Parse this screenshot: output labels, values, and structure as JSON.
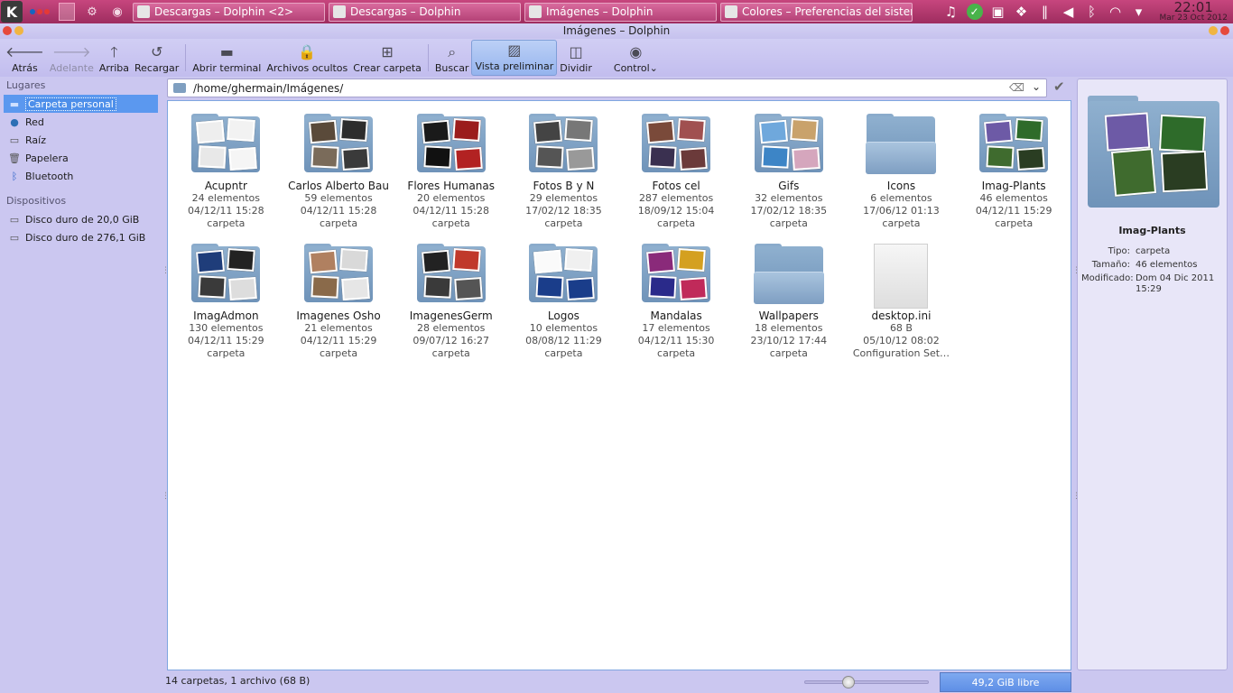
{
  "panel": {
    "tasks": [
      {
        "label": "Descargas – Dolphin <2>"
      },
      {
        "label": "Descargas – Dolphin"
      },
      {
        "label": "Imágenes – Dolphin"
      },
      {
        "label": "Colores – Preferencias del sistema"
      }
    ],
    "clock_time": "22:01",
    "clock_date": "Mar 23 Oct 2012"
  },
  "window": {
    "title": "Imágenes – Dolphin"
  },
  "toolbar": {
    "back": "Atrás",
    "forward": "Adelante",
    "up": "Arriba",
    "reload": "Recargar",
    "terminal": "Abrir terminal",
    "hidden": "Archivos ocultos",
    "new_folder": "Crear carpeta",
    "search": "Buscar",
    "preview": "Vista preliminar",
    "split": "Dividir",
    "control": "Control"
  },
  "places": {
    "heading": "Lugares",
    "items": [
      {
        "label": "Carpeta personal",
        "icon": "home-icon"
      },
      {
        "label": "Red",
        "icon": "network-icon"
      },
      {
        "label": "Raíz",
        "icon": "drive-icon"
      },
      {
        "label": "Papelera",
        "icon": "trash-icon"
      },
      {
        "label": "Bluetooth",
        "icon": "bluetooth-icon"
      }
    ],
    "devices_heading": "Dispositivos",
    "devices": [
      {
        "label": "Disco duro de 20,0 GiB"
      },
      {
        "label": "Disco duro de 276,1 GiB"
      }
    ]
  },
  "location": {
    "path": "/home/ghermain/Imágenes/"
  },
  "files": [
    {
      "name": "Acupntr",
      "count": "24 elementos",
      "date": "04/12/11 15:28",
      "type": "carpeta"
    },
    {
      "name": "Carlos Alberto Bau",
      "count": "59 elementos",
      "date": "04/12/11 15:28",
      "type": "carpeta"
    },
    {
      "name": "Flores Humanas",
      "count": "20 elementos",
      "date": "04/12/11 15:28",
      "type": "carpeta"
    },
    {
      "name": "Fotos B y N",
      "count": "29 elementos",
      "date": "17/02/12 18:35",
      "type": "carpeta"
    },
    {
      "name": "Fotos cel",
      "count": "287 elementos",
      "date": "18/09/12 15:04",
      "type": "carpeta"
    },
    {
      "name": "Gifs",
      "count": "32 elementos",
      "date": "17/02/12 18:35",
      "type": "carpeta"
    },
    {
      "name": "Icons",
      "count": "6 elementos",
      "date": "17/06/12 01:13",
      "type": "carpeta"
    },
    {
      "name": "Imag-Plants",
      "count": "46 elementos",
      "date": "04/12/11 15:29",
      "type": "carpeta"
    },
    {
      "name": "ImagAdmon",
      "count": "130 elementos",
      "date": "04/12/11 15:29",
      "type": "carpeta"
    },
    {
      "name": "Imagenes Osho",
      "count": "21 elementos",
      "date": "04/12/11 15:29",
      "type": "carpeta"
    },
    {
      "name": "ImagenesGerm",
      "count": "28 elementos",
      "date": "09/07/12 16:27",
      "type": "carpeta"
    },
    {
      "name": "Logos",
      "count": "10 elementos",
      "date": "08/08/12 11:29",
      "type": "carpeta"
    },
    {
      "name": "Mandalas",
      "count": "17 elementos",
      "date": "04/12/11 15:30",
      "type": "carpeta"
    },
    {
      "name": "Wallpapers",
      "count": "18 elementos",
      "date": "23/10/12 17:44",
      "type": "carpeta"
    },
    {
      "name": "desktop.ini",
      "count": "68 B",
      "date": "05/10/12 08:02",
      "type": "Configuration Set…"
    }
  ],
  "info": {
    "title": "Imag-Plants",
    "type_label": "Tipo:",
    "type_value": "carpeta",
    "size_label": "Tamaño:",
    "size_value": "46 elementos",
    "modified_label": "Modificado:",
    "modified_value": "Dom 04 Dic 2011 15:29"
  },
  "status": {
    "summary": "14 carpetas, 1 archivo (68 B)",
    "free_space": "49,2 GiB libre",
    "zoom_fraction": 0.33
  },
  "colors": {
    "panel": "#b5376f",
    "chrome": "#c8c4f0",
    "selection": "#5b98ef",
    "folder": "#7e9ec2"
  }
}
